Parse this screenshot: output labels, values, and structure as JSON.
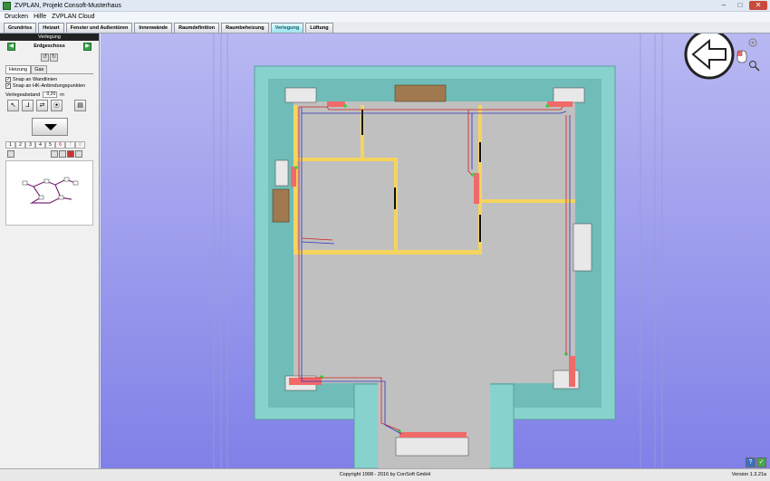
{
  "window": {
    "title": "ZVPLAN, Projekt Consoft-Musterhaus"
  },
  "menu": {
    "items": [
      "Drucken",
      "Hilfe",
      "ZVPLAN Cloud"
    ]
  },
  "tabs": [
    {
      "label": "Grundriss",
      "active": false
    },
    {
      "label": "Heizart",
      "active": false
    },
    {
      "label": "Fenster und Außentüren",
      "active": false
    },
    {
      "label": "Innenwände",
      "active": false
    },
    {
      "label": "Raumdefinition",
      "active": false
    },
    {
      "label": "Raumbeheizung",
      "active": false
    },
    {
      "label": "Verlegung",
      "active": true
    },
    {
      "label": "Lüftung",
      "active": false
    }
  ],
  "sidebar": {
    "header": "Verlegung",
    "floor": "Erdgeschoss",
    "subtabs": [
      {
        "label": "Heizung",
        "active": true
      },
      {
        "label": "Gas",
        "active": false
      }
    ],
    "checks": [
      {
        "label": "Snap an Wandlinien",
        "checked": true
      },
      {
        "label": "Snap an HK-Anbindungspunkten",
        "checked": true
      }
    ],
    "abstand": {
      "label": "Verlegeabstand",
      "value": "0,20",
      "unit": "m"
    },
    "num_tabs": [
      {
        "label": "1",
        "state": "normal"
      },
      {
        "label": "2",
        "state": "normal"
      },
      {
        "label": "3",
        "state": "normal"
      },
      {
        "label": "4",
        "state": "normal"
      },
      {
        "label": "5",
        "state": "normal"
      },
      {
        "label": "6",
        "state": "red"
      },
      {
        "label": "7",
        "state": "disabled"
      },
      {
        "label": "8",
        "state": "disabled"
      }
    ]
  },
  "colors": {
    "wall": "#7fcfcc",
    "floor": "#c0c0c0",
    "partition": "#f5d45e",
    "radiator": "#f06a6a",
    "pipe_red": "#d02020",
    "pipe_blue": "#3030c0",
    "sky": "#8a8ae6"
  },
  "icons": [
    "compass-arrow-icon",
    "rotate-icon",
    "mouse-icon",
    "zoom-icon",
    "help-icon",
    "ok-check-icon"
  ],
  "status": {
    "copyright": "Copyright 1998 - 2016 by ConSoft GmbH",
    "version": "Version 1.3.21a"
  }
}
